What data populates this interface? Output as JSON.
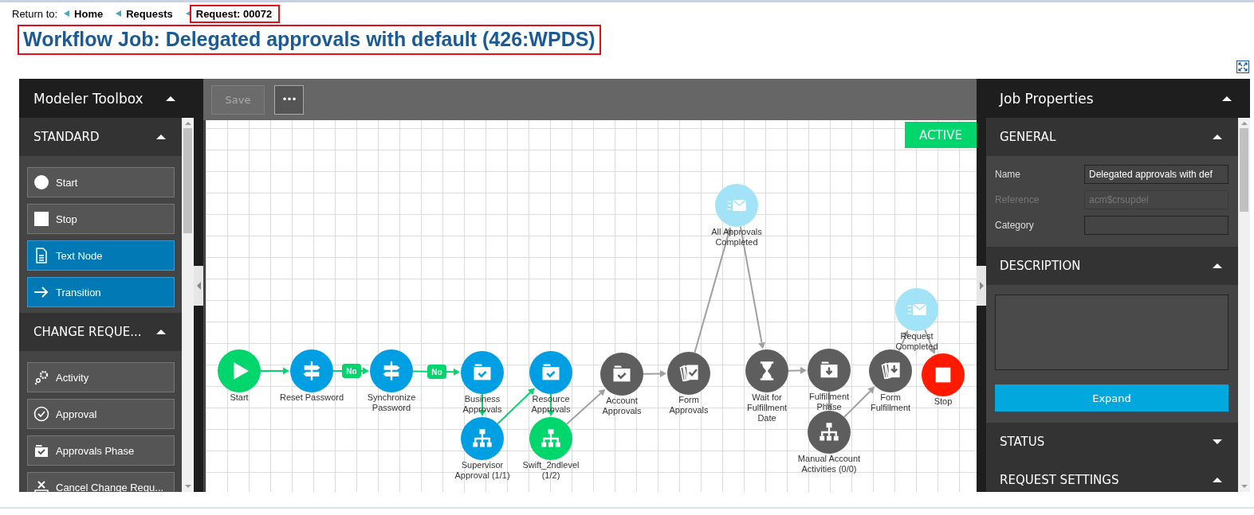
{
  "breadcrumb": {
    "label": "Return to:",
    "links": [
      {
        "text": "Home",
        "outlined": false
      },
      {
        "text": "Requests",
        "outlined": false
      },
      {
        "text": "Request: 00072",
        "outlined": true
      }
    ]
  },
  "page_title": {
    "text": "Workflow Job: Delegated approvals with default (426:WPDS)",
    "outlined": true
  },
  "toolbox": {
    "title": "Modeler Toolbox",
    "expanded": true,
    "sections": [
      {
        "title": "STANDARD",
        "expanded": true,
        "items": [
          {
            "label": "Start",
            "kind": "start",
            "highlighted": false
          },
          {
            "label": "Stop",
            "kind": "stop",
            "highlighted": false
          },
          {
            "label": "Text Node",
            "kind": "text-node",
            "highlighted": true
          },
          {
            "label": "Transition",
            "kind": "transition",
            "highlighted": true
          }
        ]
      },
      {
        "title": "CHANGE REQUE...",
        "expanded": true,
        "items": [
          {
            "label": "Activity",
            "kind": "activity",
            "highlighted": false
          },
          {
            "label": "Approval",
            "kind": "approval",
            "highlighted": false
          },
          {
            "label": "Approvals Phase",
            "kind": "approvals-phase",
            "highlighted": false
          },
          {
            "label": "Cancel Change Requ...",
            "kind": "cancel",
            "highlighted": false
          }
        ]
      }
    ]
  },
  "toolbar": {
    "buttons": [
      {
        "label": "Save",
        "kind": "save",
        "disabled": true
      },
      {
        "label": "•••",
        "kind": "more",
        "disabled": false
      }
    ]
  },
  "canvas": {
    "status": "ACTIVE",
    "nodes": [
      {
        "label": "Start",
        "kind": "start",
        "color": "#00d66b"
      },
      {
        "label": "Reset Password",
        "kind": "decision",
        "color": "#009fe3"
      },
      {
        "label": "Synchronize Password",
        "kind": "decision",
        "color": "#009fe3"
      },
      {
        "label": "Business Approvals",
        "kind": "approvals-phase",
        "color": "#009fe3"
      },
      {
        "label": "Resource Approvals",
        "kind": "approvals-phase",
        "color": "#009fe3"
      },
      {
        "label": "Supervisor Approval (1/1)",
        "kind": "approval",
        "color": "#009fe3"
      },
      {
        "label": "Swift_2ndlevel (1/2)",
        "kind": "approval",
        "color": "#00d66b"
      },
      {
        "label": "Account Approvals",
        "kind": "approvals-phase",
        "color": "#5e5e5e"
      },
      {
        "label": "Form Approvals",
        "kind": "form",
        "color": "#5e5e5e"
      },
      {
        "label": "All Approvals Completed",
        "kind": "notification",
        "color": "#a3e3f7"
      },
      {
        "label": "Wait for Fulfillment Date",
        "kind": "wait",
        "color": "#5e5e5e"
      },
      {
        "label": "Fulfillment Phase",
        "kind": "fulfillment-phase",
        "color": "#5e5e5e"
      },
      {
        "label": "Manual Account Activities (0/0)",
        "kind": "activity",
        "color": "#5e5e5e"
      },
      {
        "label": "Form Fulfillment",
        "kind": "fulfillment-form",
        "color": "#5e5e5e"
      },
      {
        "label": "Request Completed",
        "kind": "notification",
        "color": "#a3e3f7"
      },
      {
        "label": "Stop",
        "kind": "stop",
        "color": "#ff1a00"
      }
    ],
    "transitions": [
      {
        "color": "#00d66b"
      },
      {
        "color": "#00d66b",
        "label": "No"
      },
      {
        "color": "#00d66b",
        "label": "No"
      },
      {
        "color": "#00d66b"
      },
      {
        "color": "#00d66b"
      },
      {
        "color": "#00d66b"
      },
      {
        "color": "#a0a0a0"
      },
      {
        "color": "#a0a0a0"
      },
      {
        "color": "#a0a0a0"
      },
      {
        "color": "#a0a0a0"
      },
      {
        "color": "#a0a0a0"
      },
      {
        "color": "#a0a0a0"
      },
      {
        "color": "#a0a0a0"
      },
      {
        "color": "#a0a0a0"
      },
      {
        "color": "#a0a0a0"
      }
    ]
  },
  "properties": {
    "title": "Job Properties",
    "expanded": true,
    "sections": [
      {
        "title": "GENERAL",
        "expanded": true,
        "kind": "fields",
        "fields": [
          {
            "label": "Name",
            "value": "Delegated approvals with def",
            "disabled": false
          },
          {
            "label": "Reference",
            "value": "acm$crsupdel",
            "disabled": true
          },
          {
            "label": "Category",
            "disabled": false
          }
        ]
      },
      {
        "title": "DESCRIPTION",
        "expanded": true,
        "kind": "description",
        "button": "Expand"
      },
      {
        "title": "STATUS",
        "expanded": false
      },
      {
        "title": "REQUEST SETTINGS",
        "expanded": true
      }
    ]
  }
}
